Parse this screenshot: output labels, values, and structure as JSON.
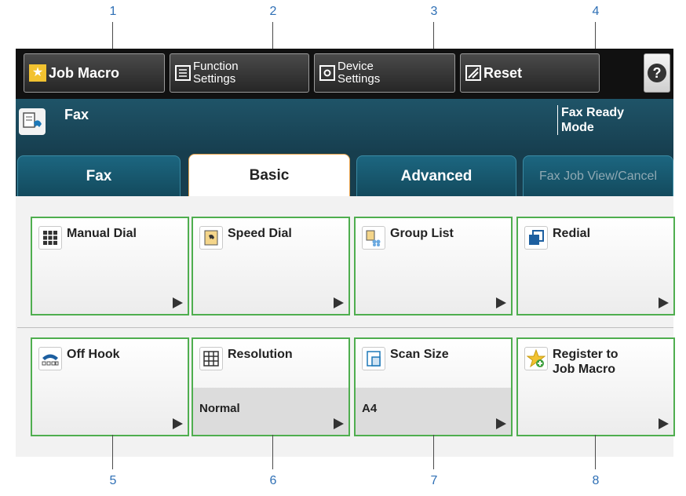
{
  "callouts": {
    "top": [
      "1",
      "2",
      "3",
      "4"
    ],
    "bottom": [
      "5",
      "6",
      "7",
      "8"
    ]
  },
  "toolbar": {
    "job_macro": "Job Macro",
    "function_settings": "Function\nSettings",
    "device_settings": "Device\nSettings",
    "reset": "Reset",
    "help": "?"
  },
  "header": {
    "title": "Fax",
    "status": "Fax Ready\nMode"
  },
  "tabs": [
    "Fax",
    "Basic",
    "Advanced",
    "Fax Job View/Cancel"
  ],
  "active_tab": "Basic",
  "tiles": [
    {
      "label": "Manual Dial",
      "icon": "keypad-icon",
      "value": ""
    },
    {
      "label": "Speed Dial",
      "icon": "speed-dial-icon",
      "value": ""
    },
    {
      "label": "Group List",
      "icon": "group-list-icon",
      "value": ""
    },
    {
      "label": "Redial",
      "icon": "redial-icon",
      "value": ""
    },
    {
      "label": "Off Hook",
      "icon": "off-hook-icon",
      "value": ""
    },
    {
      "label": "Resolution",
      "icon": "resolution-icon",
      "value": "Normal"
    },
    {
      "label": "Scan Size",
      "icon": "scan-size-icon",
      "value": "A4"
    },
    {
      "label": "Register to\nJob Macro",
      "icon": "register-macro-icon",
      "value": ""
    }
  ],
  "colors": {
    "tile_border": "#4fae4f",
    "header_bg": "#1f5468",
    "callout": "#2e6fb5"
  }
}
